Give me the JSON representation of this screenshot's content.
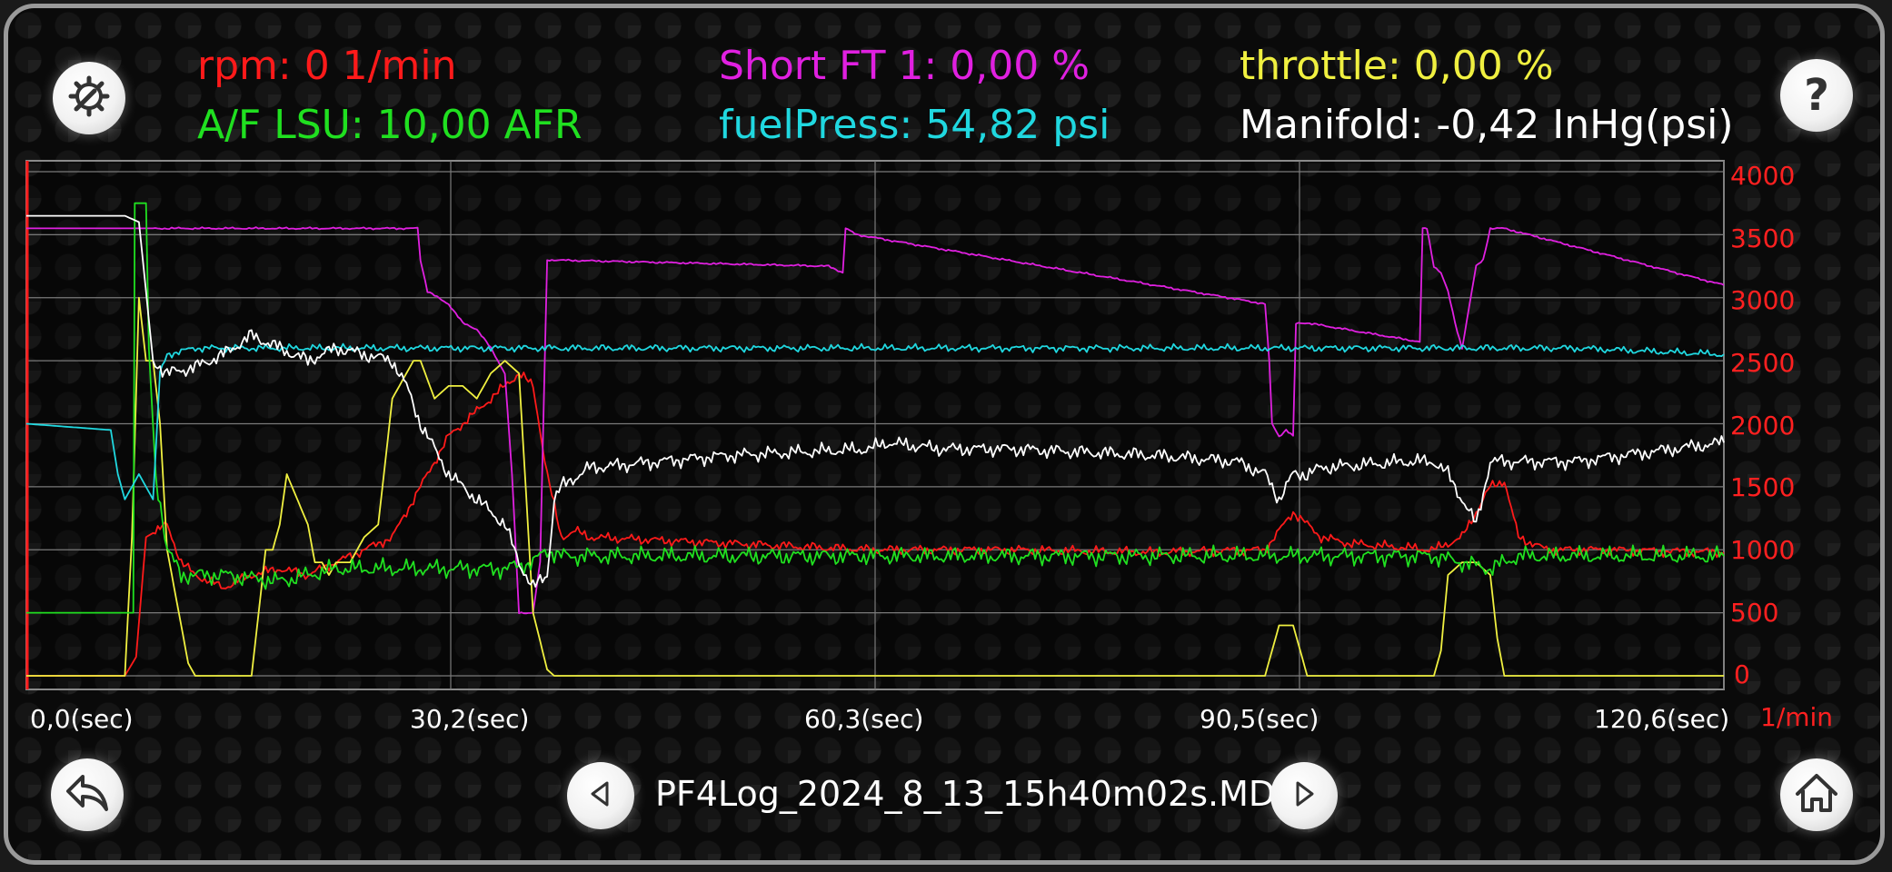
{
  "header": {
    "rpm": "rpm: 0 1/min",
    "short_ft": "Short FT 1: 0,00 %",
    "throttle": "throttle: 0,00 %",
    "af_lsu": "A/F LSU: 10,00 AFR",
    "fuel_press": "fuelPress: 54,82 psi",
    "manifold": "Manifold: -0,42 InHg(psi)"
  },
  "colors": {
    "rpm": "#ff1a1a",
    "short_ft": "#e020e0",
    "throttle": "#f0f040",
    "af_lsu": "#20e020",
    "fuel_press": "#20d8e0",
    "manifold": "#ffffff"
  },
  "footer": {
    "filename": "PF4Log_2024_8_13_15h40m02s.MDF"
  },
  "icons": {
    "settings": "gear-wrench-icon",
    "help": "question-icon",
    "back": "undo-arrow-icon",
    "prev": "triangle-left-icon",
    "next": "triangle-right-icon",
    "home": "home-icon"
  },
  "chart_data": {
    "type": "line",
    "x_tick_labels": [
      "0,0(sec)",
      "30,2(sec)",
      "60,3(sec)",
      "90,5(sec)",
      "120,6(sec)"
    ],
    "y_tick_labels": [
      "4000",
      "3500",
      "3000",
      "2500",
      "2000",
      "1500",
      "1000",
      "500",
      "0"
    ],
    "y_unit": "1/min",
    "xlim": [
      0,
      120.6
    ],
    "ylim": [
      0,
      4000
    ],
    "grid": true,
    "series": [
      {
        "name": "rpm",
        "color": "#ff1a1a",
        "x": [
          0,
          7,
          7.8,
          8.5,
          10,
          11,
          12,
          14,
          16,
          18,
          20,
          22,
          24,
          26,
          28,
          30,
          32,
          34,
          35,
          36,
          37,
          38,
          39,
          40,
          50,
          60,
          70,
          80,
          88,
          89,
          90,
          91,
          92,
          94,
          100,
          102,
          103,
          104,
          105,
          106,
          108,
          112,
          120.6
        ],
        "y": [
          0,
          0,
          150,
          1100,
          1200,
          900,
          800,
          700,
          800,
          850,
          800,
          900,
          1000,
          1100,
          1500,
          1900,
          2100,
          2300,
          2400,
          2300,
          1600,
          1100,
          1150,
          1100,
          1050,
          1000,
          1000,
          980,
          1000,
          1150,
          1300,
          1200,
          1100,
          1050,
          1000,
          1100,
          1300,
          1500,
          1550,
          1100,
          1000,
          1000,
          980
        ]
      },
      {
        "name": "Short FT 1",
        "color": "#e020e0",
        "x": [
          0,
          27.8,
          28,
          28.5,
          30,
          31,
          32,
          33,
          33.5,
          34,
          34.5,
          35,
          35.5,
          36,
          36.5,
          37,
          57,
          58,
          58.2,
          59,
          88,
          88.3,
          88.5,
          89,
          89.5,
          90,
          90.2,
          91,
          99,
          99.2,
          99.5,
          100,
          100.5,
          101,
          101.5,
          102,
          103,
          103.5,
          104,
          105,
          120.6
        ],
        "y": [
          3550,
          3550,
          3300,
          3050,
          2950,
          2800,
          2750,
          2600,
          2500,
          2400,
          1600,
          500,
          500,
          500,
          900,
          3300,
          3250,
          3200,
          3550,
          3500,
          2950,
          2500,
          2000,
          1900,
          1950,
          1900,
          2800,
          2800,
          2650,
          3550,
          3550,
          3250,
          3200,
          3050,
          2800,
          2600,
          3250,
          3300,
          3550,
          3550,
          3100
        ]
      },
      {
        "name": "throttle",
        "color": "#f0f040",
        "x": [
          0,
          7,
          7.5,
          8,
          8.5,
          9,
          9.5,
          10,
          10.5,
          11,
          11.5,
          12,
          16,
          16.5,
          17,
          17.5,
          18,
          18.5,
          20,
          20.5,
          21,
          21.5,
          22,
          23,
          24,
          25,
          26,
          27,
          27.5,
          28,
          29,
          30,
          31,
          32,
          33,
          34,
          35,
          36,
          37,
          37.5,
          38,
          88,
          88.5,
          89,
          90,
          90.5,
          91,
          92,
          100,
          100.5,
          101,
          102,
          103,
          104,
          104.5,
          105,
          120.6
        ],
        "y": [
          0,
          0,
          1100,
          3000,
          2500,
          2500,
          2000,
          1000,
          700,
          400,
          100,
          0,
          0,
          500,
          1000,
          1000,
          1200,
          1600,
          1200,
          900,
          900,
          800,
          900,
          900,
          1100,
          1200,
          2200,
          2400,
          2500,
          2500,
          2200,
          2300,
          2300,
          2200,
          2400,
          2500,
          2400,
          500,
          50,
          0,
          0,
          0,
          200,
          400,
          400,
          200,
          0,
          0,
          0,
          200,
          800,
          900,
          900,
          800,
          300,
          0,
          0
        ]
      },
      {
        "name": "A/F LSU",
        "color": "#20e020",
        "x": [
          0,
          7.6,
          7.7,
          8.5,
          8.7,
          9.2,
          10,
          11,
          12,
          14,
          18,
          22,
          26,
          30,
          34,
          36,
          37,
          38,
          40,
          50,
          60,
          70,
          80,
          88,
          90,
          92,
          100,
          102,
          104,
          106,
          110,
          120.6
        ],
        "y": [
          500,
          500,
          3750,
          3750,
          2600,
          1600,
          1000,
          800,
          800,
          800,
          750,
          850,
          850,
          850,
          850,
          900,
          1000,
          950,
          950,
          950,
          950,
          950,
          950,
          950,
          950,
          950,
          950,
          900,
          850,
          950,
          950,
          950
        ]
      },
      {
        "name": "fuelPress",
        "color": "#20d8e0",
        "x": [
          0,
          6,
          6.5,
          7,
          8,
          9,
          9.5,
          10,
          12,
          20,
          30,
          40,
          50,
          60,
          70,
          80,
          90,
          100,
          110,
          120.6
        ],
        "y": [
          2000,
          1950,
          1600,
          1400,
          1600,
          1400,
          2400,
          2550,
          2600,
          2600,
          2600,
          2600,
          2600,
          2600,
          2600,
          2600,
          2600,
          2600,
          2600,
          2550
        ]
      },
      {
        "name": "Manifold",
        "color": "#ffffff",
        "x": [
          0,
          7,
          8,
          9,
          10,
          12,
          14,
          16,
          18,
          20,
          22,
          24,
          26,
          27,
          28,
          29,
          30,
          32,
          34,
          35,
          36,
          37,
          37.5,
          38,
          40,
          50,
          60,
          61,
          65,
          70,
          80,
          86,
          88,
          89,
          90,
          91,
          92,
          98,
          100,
          101,
          102,
          103,
          104,
          105,
          106,
          110,
          120.6
        ],
        "y": [
          3650,
          3650,
          3600,
          2500,
          2400,
          2450,
          2550,
          2700,
          2600,
          2500,
          2600,
          2550,
          2500,
          2300,
          2000,
          1800,
          1600,
          1400,
          1200,
          900,
          700,
          800,
          1400,
          1500,
          1650,
          1750,
          1800,
          1850,
          1800,
          1800,
          1750,
          1700,
          1600,
          1400,
          1600,
          1600,
          1650,
          1700,
          1700,
          1600,
          1400,
          1200,
          1700,
          1700,
          1700,
          1700,
          1850
        ]
      }
    ]
  }
}
